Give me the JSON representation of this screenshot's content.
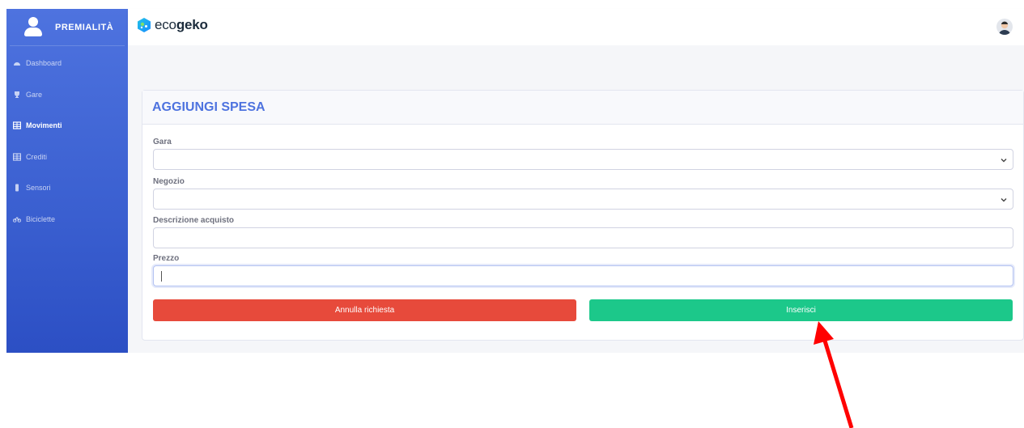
{
  "sidebar": {
    "brand": "PREMIALITÀ",
    "items": [
      {
        "label": "Dashboard",
        "icon": "dashboard-icon",
        "active": false
      },
      {
        "label": "Gare",
        "icon": "trophy-icon",
        "active": false
      },
      {
        "label": "Movimenti",
        "icon": "table-icon",
        "active": true
      },
      {
        "label": "Crediti",
        "icon": "table-icon",
        "active": false
      },
      {
        "label": "Sensori",
        "icon": "sensor-icon",
        "active": false
      },
      {
        "label": "Biciclette",
        "icon": "bicycle-icon",
        "active": false
      }
    ]
  },
  "topbar": {
    "logo_light": "eco",
    "logo_bold": "geko"
  },
  "form": {
    "title": "AGGIUNGI SPESA",
    "fields": [
      {
        "label": "Gara",
        "value": "",
        "type": "select"
      },
      {
        "label": "Negozio",
        "value": "",
        "type": "select"
      },
      {
        "label": "Descrizione acquisto",
        "value": "",
        "type": "text"
      },
      {
        "label": "Prezzo",
        "value": "",
        "type": "text",
        "focused": true
      }
    ],
    "cancel_label": "Annulla richiesta",
    "submit_label": "Inserisci"
  },
  "colors": {
    "sidebar": "#4e73df",
    "title": "#4e73df",
    "cancel": "#e74a3b",
    "submit": "#1cc88a",
    "annotation_arrow": "#ff0000"
  }
}
